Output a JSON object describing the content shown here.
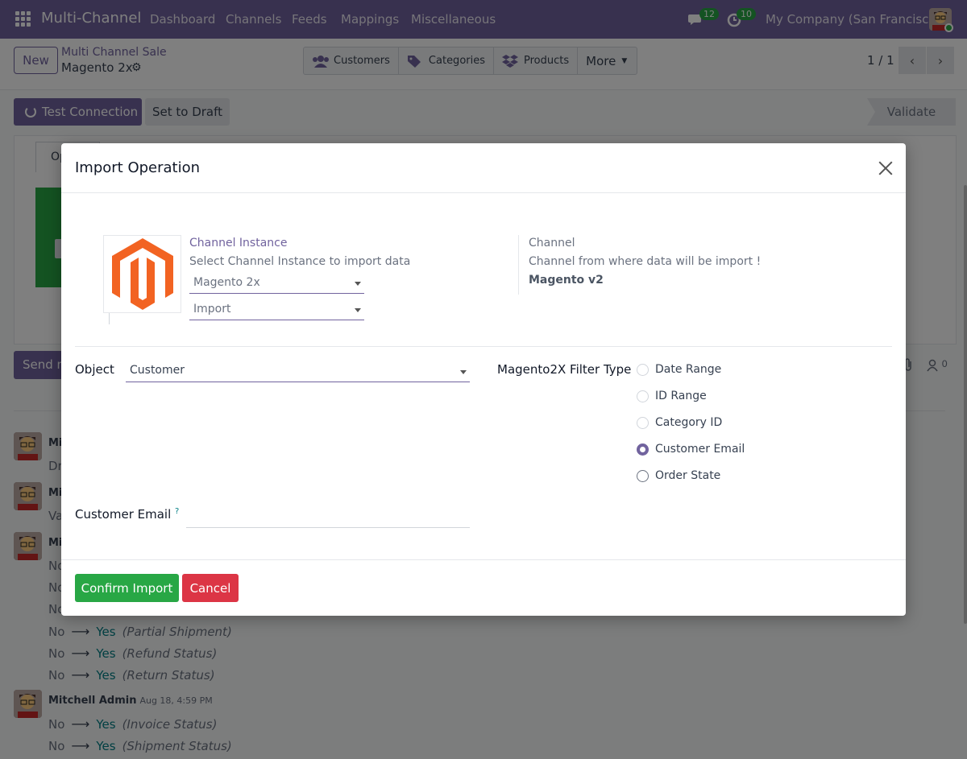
{
  "navbar": {
    "app_title": "Multi-Channel",
    "menu": [
      "Dashboard",
      "Channels",
      "Feeds",
      "Mappings",
      "Miscellaneous"
    ],
    "messages_count": "12",
    "activities_count": "10",
    "company": "My Company (San Francisco)"
  },
  "control": {
    "new_label": "New",
    "breadcrumb_parent": "Multi Channel Sale",
    "breadcrumb_current": "Magento 2x",
    "smart_buttons": [
      "Customers",
      "Categories",
      "Products"
    ],
    "more_label": "More",
    "pager": "1 / 1"
  },
  "status": {
    "test_connection": "Test Connection",
    "set_to_draft": "Set to Draft",
    "validate": "Validate"
  },
  "background": {
    "tab_label": "Op",
    "send_button": "Send m",
    "followers_count": "0",
    "messages": [
      {
        "name": "Mi",
        "lines": [
          "Dr"
        ]
      },
      {
        "name": "Mi",
        "lines": [
          "Va"
        ]
      },
      {
        "name": "Mi",
        "lines": [
          "No",
          "No",
          "No"
        ]
      }
    ],
    "changes": [
      {
        "from": "No",
        "to": "Yes",
        "field": "(Partial Shipment)"
      },
      {
        "from": "No",
        "to": "Yes",
        "field": "(Refund Status)"
      },
      {
        "from": "No",
        "to": "Yes",
        "field": "(Return Status)"
      }
    ],
    "last_message": {
      "author": "Mitchell Admin",
      "date": "Aug 18, 4:59 PM",
      "changes": [
        {
          "from": "No",
          "to": "Yes",
          "field": "(Invoice Status)"
        },
        {
          "from": "No",
          "to": "Yes",
          "field": "(Shipment Status)"
        }
      ]
    }
  },
  "modal": {
    "title": "Import Operation",
    "channel_instance_label": "Channel Instance",
    "channel_instance_desc": "Select Channel Instance to import data",
    "instance_value": "Magento 2x",
    "operation_value": "Import",
    "channel_label": "Channel",
    "channel_desc": "Channel from where data will be import !",
    "channel_value": "Magento v2",
    "object_label": "Object",
    "object_value": "Customer",
    "filter_label": "Magento2X Filter Type",
    "filter_options": [
      "Date Range",
      "ID Range",
      "Category ID",
      "Customer Email",
      "Order State"
    ],
    "filter_selected": "Customer Email",
    "email_label": "Customer Email",
    "email_help": "?",
    "confirm_label": "Confirm Import",
    "cancel_label": "Cancel"
  },
  "colors": {
    "brand": "#71639e",
    "success": "#28a745",
    "danger": "#dc3545",
    "teal": "#017e84"
  }
}
